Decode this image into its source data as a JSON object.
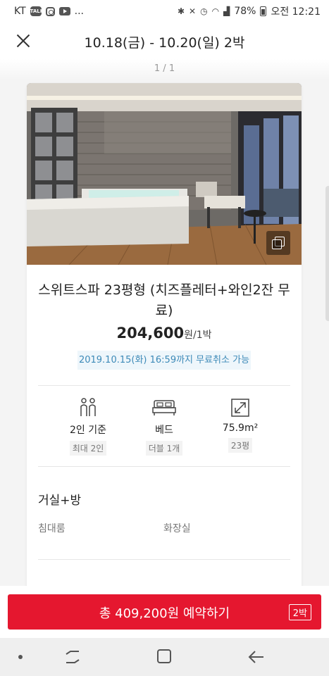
{
  "status_bar": {
    "carrier": "KT",
    "more": "...",
    "battery": "78%",
    "time": "오전 12:21"
  },
  "header": {
    "title": "10.18(금) - 10.20(일) 2박"
  },
  "pager": "1 / 1",
  "room": {
    "name": "스위트스파 23평형 (치즈플레터+와인2잔 무료)",
    "price": "204,600",
    "price_unit": "원/1박",
    "cancel_notice": "2019.10.15(화) 16:59까지 무료취소 가능"
  },
  "amenities": [
    {
      "icon": "people-icon",
      "title": "2인 기준",
      "sub": "최대 2인"
    },
    {
      "icon": "bed-icon",
      "title": "베드",
      "sub": "더블 1개"
    },
    {
      "icon": "resize-icon",
      "title": "75.9m²",
      "sub": "23평"
    }
  ],
  "rooms_section": {
    "title": "거실+방",
    "items": [
      "침대룸",
      "화장실"
    ]
  },
  "cta": {
    "label": "총 409,200원 예약하기",
    "nights": "2박",
    "color": "#e5172f"
  }
}
